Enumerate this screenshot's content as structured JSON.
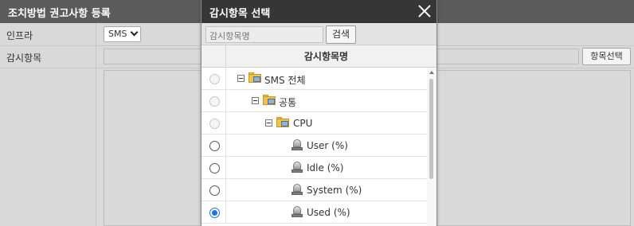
{
  "background": {
    "title": "조치방법 권고사항 등록",
    "rows": {
      "infra_label": "인프라",
      "monitor_label": "감시항목"
    },
    "infra_select_value": "SMS",
    "monitor_select_button": "항목선택"
  },
  "modal": {
    "title": "감시항목 선택",
    "search": {
      "placeholder": "감시항목명",
      "button": "검색"
    },
    "grid": {
      "column_name": "감시항목명",
      "rows": [
        {
          "label": "SMS 전체",
          "type": "folder",
          "state": "disabled"
        },
        {
          "label": "공통",
          "type": "folder",
          "state": "disabled"
        },
        {
          "label": "CPU",
          "type": "folder",
          "state": "disabled"
        },
        {
          "label": "User (%)",
          "type": "item",
          "state": "unchecked"
        },
        {
          "label": "Idle (%)",
          "type": "item",
          "state": "unchecked"
        },
        {
          "label": "System (%)",
          "type": "item",
          "state": "unchecked"
        },
        {
          "label": "Used (%)",
          "type": "item",
          "state": "checked"
        }
      ]
    }
  },
  "colors": {
    "modal_title_bg": "#363636",
    "page_header_bg": "#5b5b5b",
    "radio_checked": "#1a73e8"
  }
}
